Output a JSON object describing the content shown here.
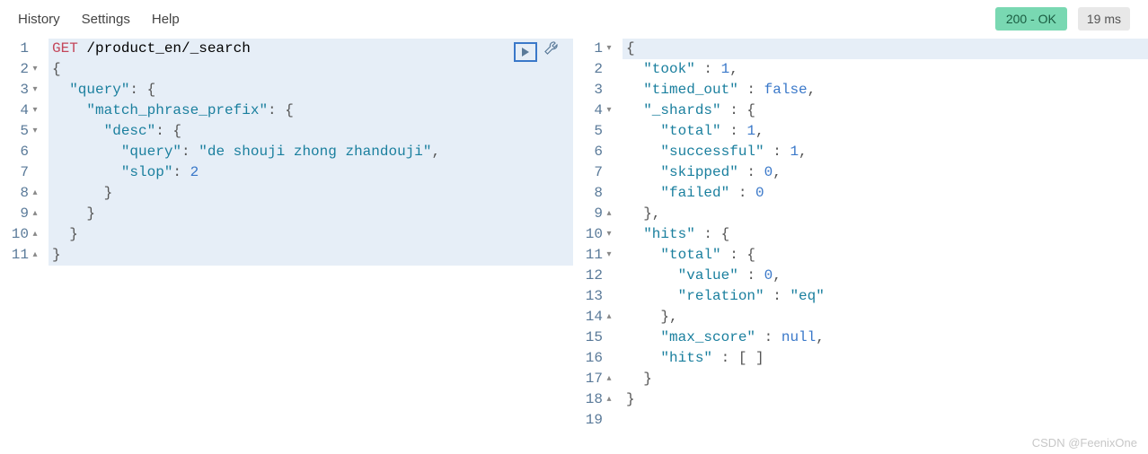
{
  "menu": {
    "history": "History",
    "settings": "Settings",
    "help": "Help"
  },
  "status": {
    "badge": "200 - OK",
    "timing": "19 ms"
  },
  "request": {
    "method": "GET",
    "path": "/product_en/_search",
    "lines": [
      {
        "n": "1",
        "fold": "",
        "hl": true,
        "segs": [
          {
            "t": "GET ",
            "c": "method"
          },
          {
            "t": "/product_en/_search",
            "c": ""
          }
        ]
      },
      {
        "n": "2",
        "fold": "▾",
        "hl": true,
        "segs": [
          {
            "t": "{",
            "c": "punct"
          }
        ]
      },
      {
        "n": "3",
        "fold": "▾",
        "hl": true,
        "segs": [
          {
            "t": "  ",
            "c": ""
          },
          {
            "t": "\"query\"",
            "c": "key"
          },
          {
            "t": ": {",
            "c": "punct"
          }
        ]
      },
      {
        "n": "4",
        "fold": "▾",
        "hl": true,
        "segs": [
          {
            "t": "    ",
            "c": ""
          },
          {
            "t": "\"match_phrase_prefix\"",
            "c": "key"
          },
          {
            "t": ": {",
            "c": "punct"
          }
        ]
      },
      {
        "n": "5",
        "fold": "▾",
        "hl": true,
        "segs": [
          {
            "t": "      ",
            "c": ""
          },
          {
            "t": "\"desc\"",
            "c": "key"
          },
          {
            "t": ": {",
            "c": "punct"
          }
        ]
      },
      {
        "n": "6",
        "fold": "",
        "hl": true,
        "segs": [
          {
            "t": "        ",
            "c": ""
          },
          {
            "t": "\"query\"",
            "c": "key"
          },
          {
            "t": ": ",
            "c": "punct"
          },
          {
            "t": "\"de shouji zhong zhandouji\"",
            "c": "string"
          },
          {
            "t": ",",
            "c": "punct"
          }
        ]
      },
      {
        "n": "7",
        "fold": "",
        "hl": true,
        "segs": [
          {
            "t": "        ",
            "c": ""
          },
          {
            "t": "\"slop\"",
            "c": "key"
          },
          {
            "t": ": ",
            "c": "punct"
          },
          {
            "t": "2",
            "c": "number"
          }
        ]
      },
      {
        "n": "8",
        "fold": "▴",
        "hl": true,
        "segs": [
          {
            "t": "      }",
            "c": "punct"
          }
        ]
      },
      {
        "n": "9",
        "fold": "▴",
        "hl": true,
        "segs": [
          {
            "t": "    }",
            "c": "punct"
          }
        ]
      },
      {
        "n": "10",
        "fold": "▴",
        "hl": true,
        "segs": [
          {
            "t": "  }",
            "c": "punct"
          }
        ]
      },
      {
        "n": "11",
        "fold": "▴",
        "hl": true,
        "segs": [
          {
            "t": "}",
            "c": "punct"
          }
        ]
      }
    ]
  },
  "response": {
    "lines": [
      {
        "n": "1",
        "fold": "▾",
        "hl": true,
        "segs": [
          {
            "t": "{",
            "c": "punct"
          }
        ]
      },
      {
        "n": "2",
        "fold": "",
        "segs": [
          {
            "t": "  ",
            "c": ""
          },
          {
            "t": "\"took\"",
            "c": "key"
          },
          {
            "t": " : ",
            "c": "punct"
          },
          {
            "t": "1",
            "c": "number"
          },
          {
            "t": ",",
            "c": "punct"
          }
        ]
      },
      {
        "n": "3",
        "fold": "",
        "segs": [
          {
            "t": "  ",
            "c": ""
          },
          {
            "t": "\"timed_out\"",
            "c": "key"
          },
          {
            "t": " : ",
            "c": "punct"
          },
          {
            "t": "false",
            "c": "bool"
          },
          {
            "t": ",",
            "c": "punct"
          }
        ]
      },
      {
        "n": "4",
        "fold": "▾",
        "segs": [
          {
            "t": "  ",
            "c": ""
          },
          {
            "t": "\"_shards\"",
            "c": "key"
          },
          {
            "t": " : {",
            "c": "punct"
          }
        ]
      },
      {
        "n": "5",
        "fold": "",
        "segs": [
          {
            "t": "    ",
            "c": ""
          },
          {
            "t": "\"total\"",
            "c": "key"
          },
          {
            "t": " : ",
            "c": "punct"
          },
          {
            "t": "1",
            "c": "number"
          },
          {
            "t": ",",
            "c": "punct"
          }
        ]
      },
      {
        "n": "6",
        "fold": "",
        "segs": [
          {
            "t": "    ",
            "c": ""
          },
          {
            "t": "\"successful\"",
            "c": "key"
          },
          {
            "t": " : ",
            "c": "punct"
          },
          {
            "t": "1",
            "c": "number"
          },
          {
            "t": ",",
            "c": "punct"
          }
        ]
      },
      {
        "n": "7",
        "fold": "",
        "segs": [
          {
            "t": "    ",
            "c": ""
          },
          {
            "t": "\"skipped\"",
            "c": "key"
          },
          {
            "t": " : ",
            "c": "punct"
          },
          {
            "t": "0",
            "c": "number"
          },
          {
            "t": ",",
            "c": "punct"
          }
        ]
      },
      {
        "n": "8",
        "fold": "",
        "segs": [
          {
            "t": "    ",
            "c": ""
          },
          {
            "t": "\"failed\"",
            "c": "key"
          },
          {
            "t": " : ",
            "c": "punct"
          },
          {
            "t": "0",
            "c": "number"
          }
        ]
      },
      {
        "n": "9",
        "fold": "▴",
        "segs": [
          {
            "t": "  },",
            "c": "punct"
          }
        ]
      },
      {
        "n": "10",
        "fold": "▾",
        "segs": [
          {
            "t": "  ",
            "c": ""
          },
          {
            "t": "\"hits\"",
            "c": "key"
          },
          {
            "t": " : {",
            "c": "punct"
          }
        ]
      },
      {
        "n": "11",
        "fold": "▾",
        "segs": [
          {
            "t": "    ",
            "c": ""
          },
          {
            "t": "\"total\"",
            "c": "key"
          },
          {
            "t": " : {",
            "c": "punct"
          }
        ]
      },
      {
        "n": "12",
        "fold": "",
        "segs": [
          {
            "t": "      ",
            "c": ""
          },
          {
            "t": "\"value\"",
            "c": "key"
          },
          {
            "t": " : ",
            "c": "punct"
          },
          {
            "t": "0",
            "c": "number"
          },
          {
            "t": ",",
            "c": "punct"
          }
        ]
      },
      {
        "n": "13",
        "fold": "",
        "segs": [
          {
            "t": "      ",
            "c": ""
          },
          {
            "t": "\"relation\"",
            "c": "key"
          },
          {
            "t": " : ",
            "c": "punct"
          },
          {
            "t": "\"eq\"",
            "c": "string"
          }
        ]
      },
      {
        "n": "14",
        "fold": "▴",
        "segs": [
          {
            "t": "    },",
            "c": "punct"
          }
        ]
      },
      {
        "n": "15",
        "fold": "",
        "segs": [
          {
            "t": "    ",
            "c": ""
          },
          {
            "t": "\"max_score\"",
            "c": "key"
          },
          {
            "t": " : ",
            "c": "punct"
          },
          {
            "t": "null",
            "c": "null"
          },
          {
            "t": ",",
            "c": "punct"
          }
        ]
      },
      {
        "n": "16",
        "fold": "",
        "segs": [
          {
            "t": "    ",
            "c": ""
          },
          {
            "t": "\"hits\"",
            "c": "key"
          },
          {
            "t": " : [ ]",
            "c": "punct"
          }
        ]
      },
      {
        "n": "17",
        "fold": "▴",
        "segs": [
          {
            "t": "  }",
            "c": "punct"
          }
        ]
      },
      {
        "n": "18",
        "fold": "▴",
        "segs": [
          {
            "t": "}",
            "c": "punct"
          }
        ]
      },
      {
        "n": "19",
        "fold": "",
        "segs": []
      }
    ]
  },
  "watermark": "CSDN @FeenixOne"
}
